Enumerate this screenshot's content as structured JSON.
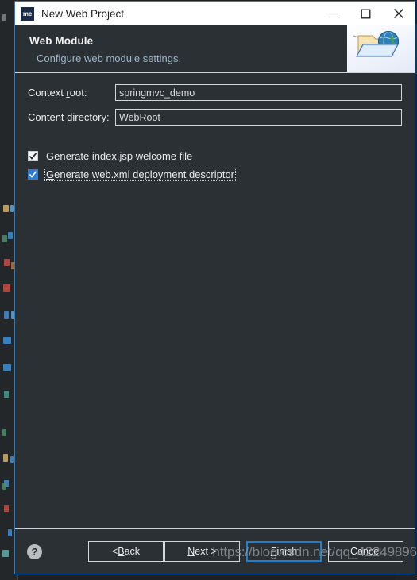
{
  "backdrop": {
    "name": "ide-editor-behind-dialog"
  },
  "titlebar": {
    "app_icon_text": "me",
    "title": "New Web Project",
    "minimize_label": "Minimize",
    "maximize_label": "Maximize",
    "close_label": "Close"
  },
  "header": {
    "title": "Web Module",
    "subtitle": "Configure web module settings.",
    "graphic_name": "web-folder-globe-icon"
  },
  "form": {
    "fields": [
      {
        "label_before": "Context ",
        "label_mnemonic": "r",
        "label_after": "oot:",
        "value": "springmvc_demo",
        "placeholder": "",
        "name": "context-root-input"
      },
      {
        "label_before": "Content ",
        "label_mnemonic": "d",
        "label_after": "irectory:",
        "value": "WebRoot",
        "placeholder": "",
        "name": "content-directory-input"
      }
    ],
    "checkboxes": [
      {
        "label_before": "Generate index.jsp welcome file",
        "label_mnemonic": "",
        "label_after": "",
        "checked": true,
        "focused": false,
        "name": "generate-index-jsp-checkbox"
      },
      {
        "label_before": "",
        "label_mnemonic": "G",
        "label_after": "enerate web.xml deployment descriptor",
        "checked": true,
        "focused": true,
        "name": "generate-web-xml-checkbox"
      }
    ]
  },
  "footer": {
    "help_label": "Help",
    "buttons": [
      {
        "before": "< ",
        "mnemonic": "B",
        "after": "ack",
        "default": false,
        "name": "back-button"
      },
      {
        "before": "",
        "mnemonic": "N",
        "after": "ext >",
        "default": false,
        "name": "next-button"
      },
      {
        "before": "",
        "mnemonic": "F",
        "after": "inish",
        "default": true,
        "name": "finish-button"
      },
      {
        "before": "Cancel",
        "mnemonic": "",
        "after": "",
        "default": false,
        "name": "cancel-button"
      }
    ]
  },
  "watermark": {
    "text": "https://blog.csdn.net/qq_42249896"
  },
  "colors": {
    "accent": "#1683d8",
    "dialog_bg": "#2b3034",
    "titlebar_bg": "#ffffff",
    "text": "#e8eaec",
    "subtitle": "#9db4c9",
    "border": "#d3d7da",
    "checkbox_focus": "#2a7fd4"
  }
}
